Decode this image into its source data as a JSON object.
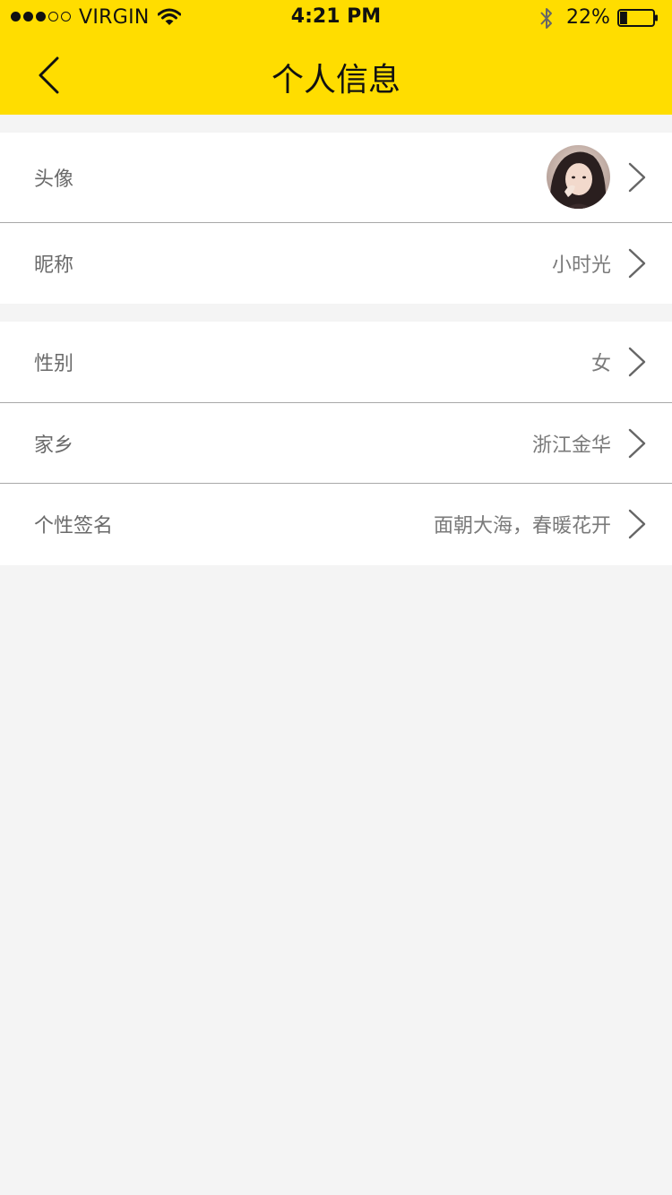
{
  "status_bar": {
    "carrier": "VIRGIN",
    "time": "4:21 PM",
    "battery_percent": "22%",
    "battery_level": 0.22,
    "signal_bars": 3,
    "signal_max": 5
  },
  "nav": {
    "title": "个人信息",
    "back_icon": "chevron-left-icon"
  },
  "profile": {
    "avatar_label": "头像",
    "nickname_label": "昵称",
    "nickname_value": "小时光",
    "gender_label": "性别",
    "gender_value": "女",
    "hometown_label": "家乡",
    "hometown_value": "浙江金华",
    "signature_label": "个性签名",
    "signature_value": "面朝大海，春暖花开"
  },
  "colors": {
    "header": "#ffdd00",
    "background": "#f4f4f4",
    "card": "#ffffff",
    "divider": "#a8a8a8",
    "label": "#6a6a6a",
    "value": "#7a7a7a"
  }
}
